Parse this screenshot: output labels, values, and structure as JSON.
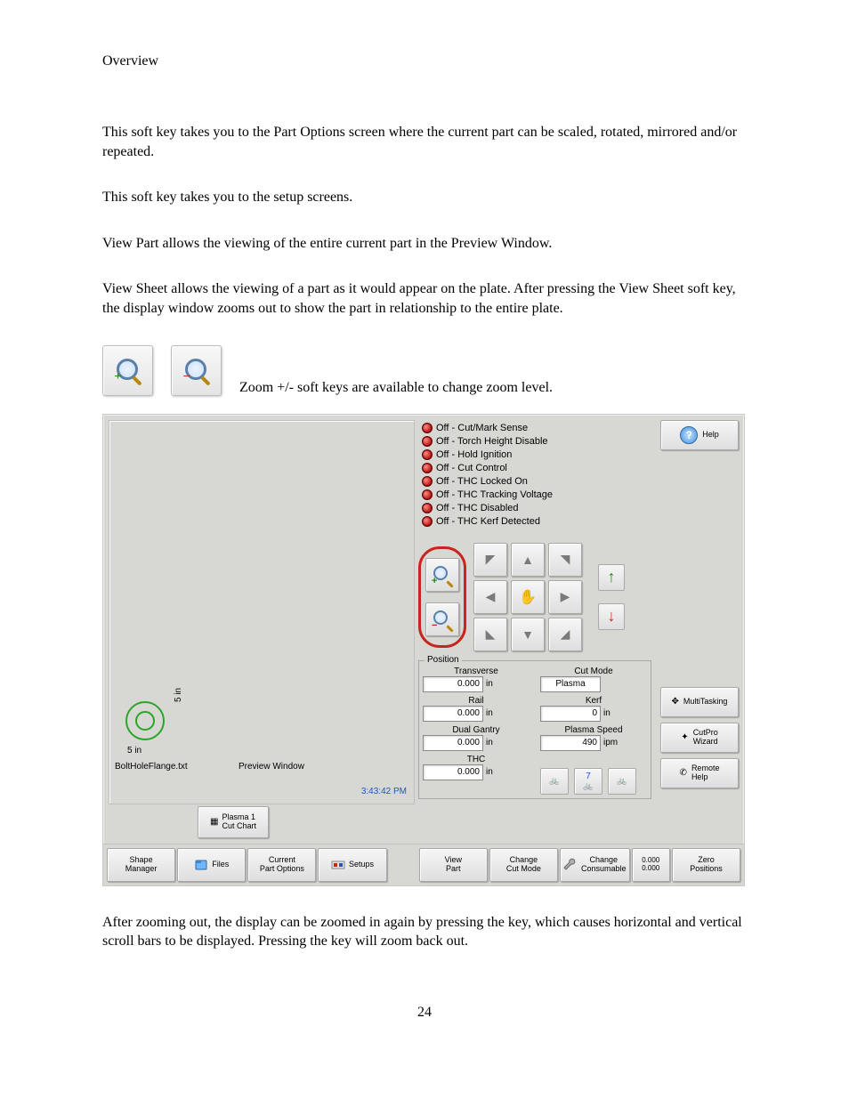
{
  "heading": "Overview",
  "paragraphs": {
    "p1": "This soft key takes you to the Part Options screen where the current part can be scaled, rotated, mirrored and/or repeated.",
    "p2": "This soft key takes you to the setup screens.",
    "p3": "View Part allows the viewing of the entire current part in the Preview Window.",
    "p4": "View Sheet allows the viewing of a part as it would appear on the plate. After pressing the View Sheet soft key, the display window zooms out to show the part in relationship to the entire plate.",
    "zoomline": "Zoom +/- soft keys are available to change zoom level.",
    "after": "After zooming out, the display can be zoomed in again by pressing the    key, which causes horizontal and vertical scroll bars to be displayed. Pressing the   key will zoom back out."
  },
  "screenshot": {
    "status": [
      "Off  -  Cut/Mark Sense",
      "Off  -  Torch Height Disable",
      "Off  -  Hold Ignition",
      "Off  -  Cut Control",
      "Off  -  THC Locked On",
      "Off  -  THC Tracking Voltage",
      "Off  -  THC Disabled",
      "Off  -  THC Kerf Detected"
    ],
    "help_label": "Help",
    "side": {
      "multitasking": "MultiTasking",
      "cutpro": "CutPro\nWizard",
      "remote": "Remote\nHelp"
    },
    "preview": {
      "yscale": "5 in",
      "xscale": "5 in",
      "filename": "BoltHoleFlange.txt",
      "label": "Preview Window",
      "time": "3:43:42 PM"
    },
    "position": {
      "title": "Position",
      "transverse": {
        "label": "Transverse",
        "value": "0.000",
        "unit": "in"
      },
      "rail": {
        "label": "Rail",
        "value": "0.000",
        "unit": "in"
      },
      "dualgantry": {
        "label": "Dual Gantry",
        "value": "0.000",
        "unit": "in"
      },
      "thc": {
        "label": "THC",
        "value": "0.000",
        "unit": "in"
      },
      "cutmode": {
        "label": "Cut Mode",
        "value": "Plasma",
        "unit": ""
      },
      "kerf": {
        "label": "Kerf",
        "value": "0",
        "unit": "in"
      },
      "speed": {
        "label": "Plasma Speed",
        "value": "490",
        "unit": "ipm"
      }
    },
    "bike_mid": "7",
    "cutchart": "Plasma 1\nCut Chart",
    "softkeys": {
      "shape": "Shape\nManager",
      "files": "Files",
      "part": "Current\nPart Options",
      "setups": "Setups",
      "view": "View\nPart",
      "cutmode": "Change\nCut Mode",
      "consum": "Change\nConsumable",
      "zero": "Zero\nPositions",
      "zval": "0.000\n0.000"
    }
  },
  "page_number": "24"
}
